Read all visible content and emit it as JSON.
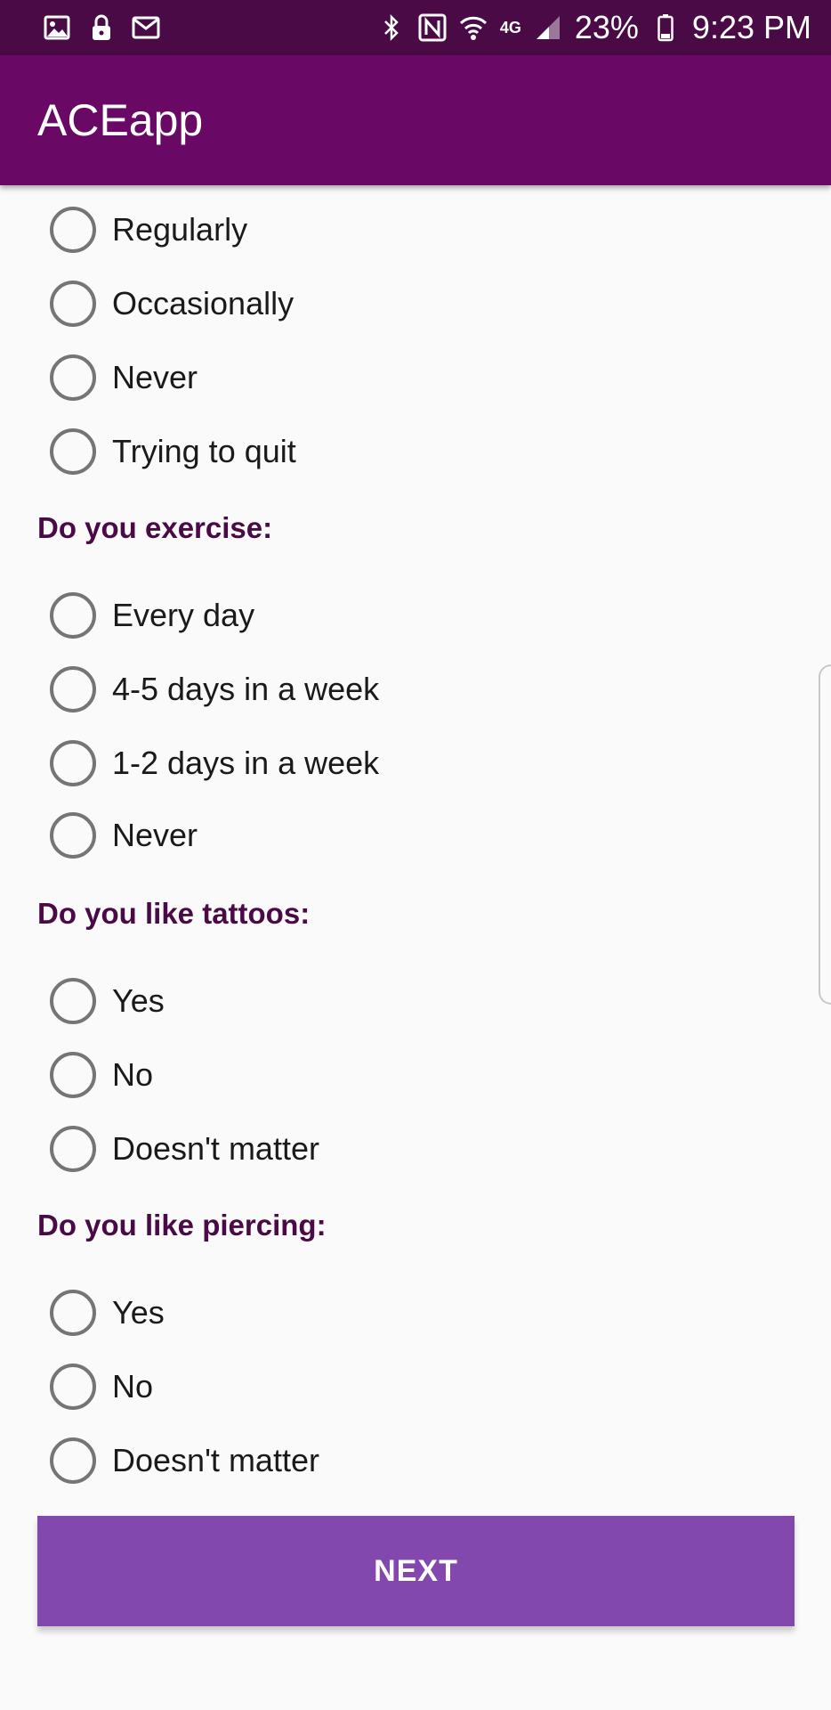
{
  "status_bar": {
    "left_icons": [
      "image-icon",
      "lock-icon",
      "mail-icon"
    ],
    "right_icons": [
      "bluetooth-icon",
      "nfc-icon",
      "wifi-icon",
      "network-4g-icon",
      "signal-icon",
      "battery-icon"
    ],
    "network_label": "4G",
    "battery_percent": "23%",
    "time": "9:23 PM"
  },
  "app_bar": {
    "title": "ACEapp"
  },
  "smoking": {
    "options": [
      "Regularly",
      "Occasionally",
      "Never",
      "Trying to quit"
    ]
  },
  "exercise": {
    "question": "Do you exercise:",
    "options": [
      "Every day",
      "4-5 days in a week",
      "1-2 days in a week",
      "Never"
    ]
  },
  "tattoos": {
    "question": "Do you like tattoos:",
    "options": [
      "Yes",
      "No",
      "Doesn't matter"
    ]
  },
  "piercing": {
    "question": "Do you like piercing:",
    "options": [
      "Yes",
      "No",
      "Doesn't matter"
    ]
  },
  "next_button": {
    "label": "NEXT"
  },
  "colors": {
    "status_bar": "#4a0a45",
    "app_bar": "#690965",
    "question_text": "#4a0a45",
    "radio_border": "#757575",
    "next_button": "#8248ad"
  }
}
